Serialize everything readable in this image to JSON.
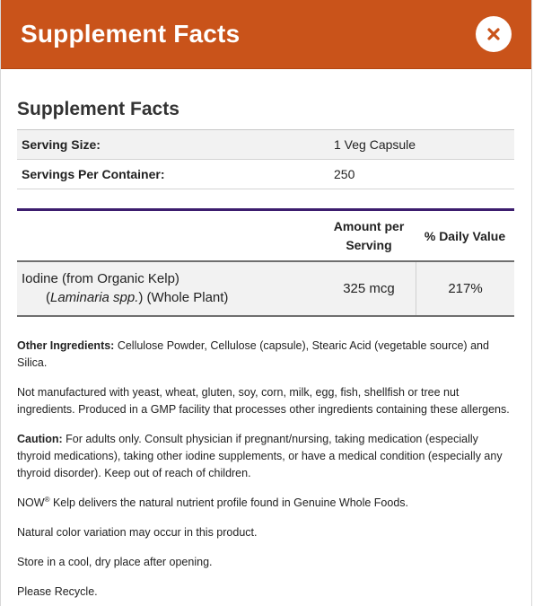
{
  "header": {
    "title": "Supplement Facts",
    "close_icon": "close-icon"
  },
  "facts": {
    "title": "Supplement Facts",
    "serving": [
      {
        "label": "Serving Size:",
        "value": "1 Veg Capsule"
      },
      {
        "label": "Servings Per Container:",
        "value": "250"
      }
    ],
    "columns": {
      "amount_line1": "Amount per",
      "amount_line2": "Serving",
      "daily_value": "% Daily Value"
    },
    "nutrient": {
      "name": "Iodine (from Organic Kelp)",
      "sub_open": "(",
      "sub_italic": "Laminaria spp.",
      "sub_rest": ") (Whole Plant)",
      "amount": "325 mcg",
      "dv": "217%"
    }
  },
  "notes": {
    "other_label": "Other Ingredients:",
    "other_text": " Cellulose Powder, Cellulose (capsule), Stearic Acid (vegetable source) and Silica.",
    "allergens": "Not manufactured with yeast, wheat, gluten, soy, corn, milk, egg, fish, shellfish or tree nut ingredients. Produced in a GMP facility that processes other ingredients containing these allergens.",
    "caution_label": "Caution:",
    "caution_text": " For adults only. Consult physician if pregnant/nursing, taking medication (especially thyroid medications), taking other iodine supplements, or have a medical condition (especially any thyroid disorder). Keep out of reach of children.",
    "now_brand": "NOW",
    "now_reg": "®",
    "now_text": " Kelp delivers the natural nutrient profile found in Genuine Whole Foods.",
    "color_variation": "Natural color variation may occur in this product.",
    "storage": "Store in a cool, dry place after opening.",
    "recycle": "Please Recycle."
  }
}
